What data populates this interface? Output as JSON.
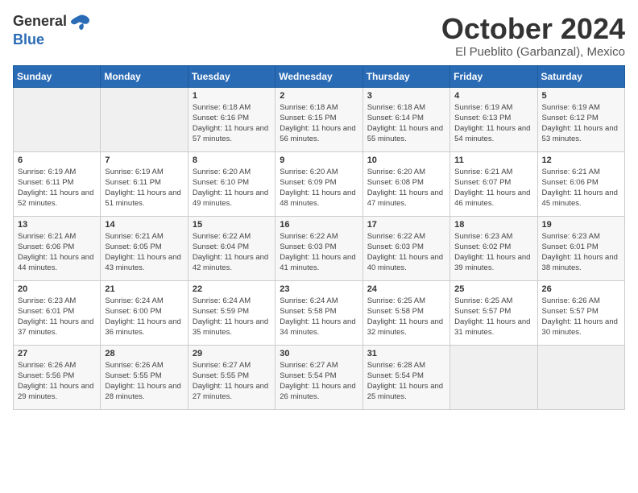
{
  "header": {
    "logo_general": "General",
    "logo_blue": "Blue",
    "month": "October 2024",
    "location": "El Pueblito (Garbanzal), Mexico"
  },
  "days_of_week": [
    "Sunday",
    "Monday",
    "Tuesday",
    "Wednesday",
    "Thursday",
    "Friday",
    "Saturday"
  ],
  "weeks": [
    [
      {
        "day": "",
        "sunrise": "",
        "sunset": "",
        "daylight": ""
      },
      {
        "day": "",
        "sunrise": "",
        "sunset": "",
        "daylight": ""
      },
      {
        "day": "1",
        "sunrise": "Sunrise: 6:18 AM",
        "sunset": "Sunset: 6:16 PM",
        "daylight": "Daylight: 11 hours and 57 minutes."
      },
      {
        "day": "2",
        "sunrise": "Sunrise: 6:18 AM",
        "sunset": "Sunset: 6:15 PM",
        "daylight": "Daylight: 11 hours and 56 minutes."
      },
      {
        "day": "3",
        "sunrise": "Sunrise: 6:18 AM",
        "sunset": "Sunset: 6:14 PM",
        "daylight": "Daylight: 11 hours and 55 minutes."
      },
      {
        "day": "4",
        "sunrise": "Sunrise: 6:19 AM",
        "sunset": "Sunset: 6:13 PM",
        "daylight": "Daylight: 11 hours and 54 minutes."
      },
      {
        "day": "5",
        "sunrise": "Sunrise: 6:19 AM",
        "sunset": "Sunset: 6:12 PM",
        "daylight": "Daylight: 11 hours and 53 minutes."
      }
    ],
    [
      {
        "day": "6",
        "sunrise": "Sunrise: 6:19 AM",
        "sunset": "Sunset: 6:11 PM",
        "daylight": "Daylight: 11 hours and 52 minutes."
      },
      {
        "day": "7",
        "sunrise": "Sunrise: 6:19 AM",
        "sunset": "Sunset: 6:11 PM",
        "daylight": "Daylight: 11 hours and 51 minutes."
      },
      {
        "day": "8",
        "sunrise": "Sunrise: 6:20 AM",
        "sunset": "Sunset: 6:10 PM",
        "daylight": "Daylight: 11 hours and 49 minutes."
      },
      {
        "day": "9",
        "sunrise": "Sunrise: 6:20 AM",
        "sunset": "Sunset: 6:09 PM",
        "daylight": "Daylight: 11 hours and 48 minutes."
      },
      {
        "day": "10",
        "sunrise": "Sunrise: 6:20 AM",
        "sunset": "Sunset: 6:08 PM",
        "daylight": "Daylight: 11 hours and 47 minutes."
      },
      {
        "day": "11",
        "sunrise": "Sunrise: 6:21 AM",
        "sunset": "Sunset: 6:07 PM",
        "daylight": "Daylight: 11 hours and 46 minutes."
      },
      {
        "day": "12",
        "sunrise": "Sunrise: 6:21 AM",
        "sunset": "Sunset: 6:06 PM",
        "daylight": "Daylight: 11 hours and 45 minutes."
      }
    ],
    [
      {
        "day": "13",
        "sunrise": "Sunrise: 6:21 AM",
        "sunset": "Sunset: 6:06 PM",
        "daylight": "Daylight: 11 hours and 44 minutes."
      },
      {
        "day": "14",
        "sunrise": "Sunrise: 6:21 AM",
        "sunset": "Sunset: 6:05 PM",
        "daylight": "Daylight: 11 hours and 43 minutes."
      },
      {
        "day": "15",
        "sunrise": "Sunrise: 6:22 AM",
        "sunset": "Sunset: 6:04 PM",
        "daylight": "Daylight: 11 hours and 42 minutes."
      },
      {
        "day": "16",
        "sunrise": "Sunrise: 6:22 AM",
        "sunset": "Sunset: 6:03 PM",
        "daylight": "Daylight: 11 hours and 41 minutes."
      },
      {
        "day": "17",
        "sunrise": "Sunrise: 6:22 AM",
        "sunset": "Sunset: 6:03 PM",
        "daylight": "Daylight: 11 hours and 40 minutes."
      },
      {
        "day": "18",
        "sunrise": "Sunrise: 6:23 AM",
        "sunset": "Sunset: 6:02 PM",
        "daylight": "Daylight: 11 hours and 39 minutes."
      },
      {
        "day": "19",
        "sunrise": "Sunrise: 6:23 AM",
        "sunset": "Sunset: 6:01 PM",
        "daylight": "Daylight: 11 hours and 38 minutes."
      }
    ],
    [
      {
        "day": "20",
        "sunrise": "Sunrise: 6:23 AM",
        "sunset": "Sunset: 6:01 PM",
        "daylight": "Daylight: 11 hours and 37 minutes."
      },
      {
        "day": "21",
        "sunrise": "Sunrise: 6:24 AM",
        "sunset": "Sunset: 6:00 PM",
        "daylight": "Daylight: 11 hours and 36 minutes."
      },
      {
        "day": "22",
        "sunrise": "Sunrise: 6:24 AM",
        "sunset": "Sunset: 5:59 PM",
        "daylight": "Daylight: 11 hours and 35 minutes."
      },
      {
        "day": "23",
        "sunrise": "Sunrise: 6:24 AM",
        "sunset": "Sunset: 5:58 PM",
        "daylight": "Daylight: 11 hours and 34 minutes."
      },
      {
        "day": "24",
        "sunrise": "Sunrise: 6:25 AM",
        "sunset": "Sunset: 5:58 PM",
        "daylight": "Daylight: 11 hours and 32 minutes."
      },
      {
        "day": "25",
        "sunrise": "Sunrise: 6:25 AM",
        "sunset": "Sunset: 5:57 PM",
        "daylight": "Daylight: 11 hours and 31 minutes."
      },
      {
        "day": "26",
        "sunrise": "Sunrise: 6:26 AM",
        "sunset": "Sunset: 5:57 PM",
        "daylight": "Daylight: 11 hours and 30 minutes."
      }
    ],
    [
      {
        "day": "27",
        "sunrise": "Sunrise: 6:26 AM",
        "sunset": "Sunset: 5:56 PM",
        "daylight": "Daylight: 11 hours and 29 minutes."
      },
      {
        "day": "28",
        "sunrise": "Sunrise: 6:26 AM",
        "sunset": "Sunset: 5:55 PM",
        "daylight": "Daylight: 11 hours and 28 minutes."
      },
      {
        "day": "29",
        "sunrise": "Sunrise: 6:27 AM",
        "sunset": "Sunset: 5:55 PM",
        "daylight": "Daylight: 11 hours and 27 minutes."
      },
      {
        "day": "30",
        "sunrise": "Sunrise: 6:27 AM",
        "sunset": "Sunset: 5:54 PM",
        "daylight": "Daylight: 11 hours and 26 minutes."
      },
      {
        "day": "31",
        "sunrise": "Sunrise: 6:28 AM",
        "sunset": "Sunset: 5:54 PM",
        "daylight": "Daylight: 11 hours and 25 minutes."
      },
      {
        "day": "",
        "sunrise": "",
        "sunset": "",
        "daylight": ""
      },
      {
        "day": "",
        "sunrise": "",
        "sunset": "",
        "daylight": ""
      }
    ]
  ]
}
